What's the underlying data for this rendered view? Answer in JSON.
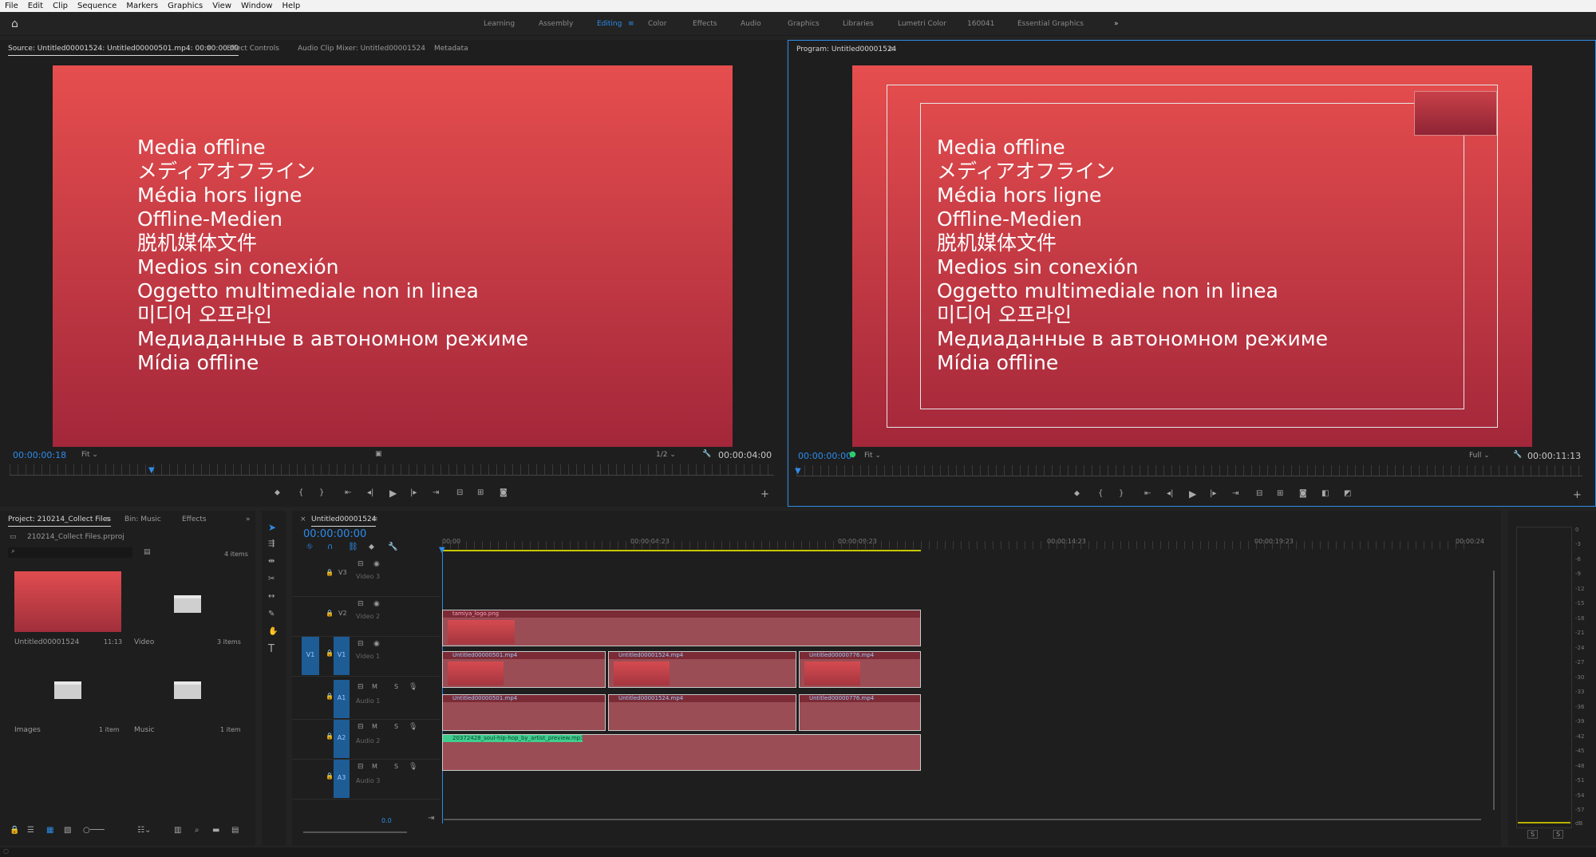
{
  "menu": [
    "File",
    "Edit",
    "Clip",
    "Sequence",
    "Markers",
    "Graphics",
    "View",
    "Window",
    "Help"
  ],
  "workspaces": [
    "Learning",
    "Assembly",
    "Editing",
    "Color",
    "Effects",
    "Audio",
    "Graphics",
    "Libraries",
    "Lumetri Color",
    "160041",
    "Essential Graphics"
  ],
  "workspace_active": "Editing",
  "source": {
    "tab": "Source: Untitled00001524: Untitled00000501.mp4: 00:00:00:00",
    "tabs": [
      "Effect Controls",
      "Audio Clip Mixer: Untitled00001524",
      "Metadata"
    ],
    "timecode": "00:00:00:18",
    "fit": "Fit",
    "res": "1/2",
    "duration": "00:00:04:00"
  },
  "program": {
    "tab": "Program: Untitled00001524",
    "timecode": "00:00:00:00",
    "fit": "Fit",
    "res": "Full",
    "duration": "00:00:11:13"
  },
  "offline_lines": [
    "Media offline",
    "メディアオフライン",
    "Média hors ligne",
    "Offline-Medien",
    "脱机媒体文件",
    "Medios sin conexión",
    "Oggetto multimediale non in linea",
    "미디어 오프라인",
    "Медиаданные в автономном режиме",
    "Mídia offline"
  ],
  "project": {
    "tabs": [
      "Project: 210214_Collect Files",
      "Bin: Music",
      "Effects"
    ],
    "file": "210214_Collect Files.prproj",
    "count": "4 items",
    "items": [
      {
        "name": "Untitled00001524",
        "meta": "11:13"
      },
      {
        "name": "Video",
        "meta": "3 items"
      },
      {
        "name": "Images",
        "meta": "1 item"
      },
      {
        "name": "Music",
        "meta": "1 item"
      }
    ]
  },
  "timeline": {
    "tab": "Untitled00001524",
    "timecode": "00:00:00:00",
    "ruler": [
      "00:00",
      "00:00:04:23",
      "00:00:09:23",
      "00:00:14:23",
      "00:00:19:23",
      "00:00:24"
    ],
    "zoom": "0.0",
    "tracks": [
      {
        "id": "V3",
        "name": "Video 3"
      },
      {
        "id": "V2",
        "name": "Video 2"
      },
      {
        "id": "V1",
        "name": "Video 1",
        "src": "V1"
      },
      {
        "id": "A1",
        "name": "Audio 1"
      },
      {
        "id": "A2",
        "name": "Audio 2"
      },
      {
        "id": "A3",
        "name": "Audio 3"
      }
    ],
    "clips": {
      "v2": "tamiya_logo.png",
      "v1": [
        "Untitled00000501.mp4",
        "Untitled00001524.mp4",
        "Untitled00000776.mp4"
      ],
      "a1": [
        "Untitled00000501.mp4",
        "Untitled00001524.mp4",
        "Untitled00000776.mp4"
      ],
      "a2": "20372428_soul-hip-hop_by_artist_preview.mp3"
    },
    "track_btns": {
      "m": "M",
      "s": "S"
    }
  },
  "meter": {
    "scale": [
      "0",
      "-3",
      "-6",
      "-9",
      "-12",
      "-15",
      "-18",
      "-21",
      "-24",
      "-27",
      "-30",
      "-33",
      "-36",
      "-39",
      "-42",
      "-45",
      "-48",
      "-51",
      "-54",
      "-57",
      "dB"
    ],
    "solo": [
      "S",
      "S"
    ]
  },
  "colors": {
    "accent": "#2d8ceb",
    "clip_video": "#9a4d54",
    "clip_audio_label": "#3ecf8e"
  }
}
